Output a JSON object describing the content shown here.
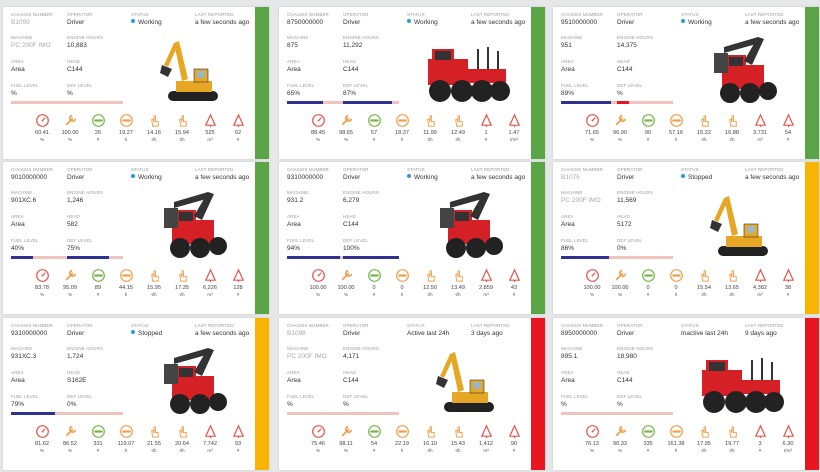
{
  "labels": {
    "chassis": "CHASSIS NUMBER",
    "operator": "OPERATOR",
    "status": "STATUS",
    "last": "LAST REPORTED",
    "machine": "MACHINE",
    "engine": "ENGINE HOURS",
    "area": "AREA",
    "head": "HEAD",
    "fuel": "FUEL LEVEL",
    "def": "DEF LEVEL"
  },
  "colors": {
    "green": "#5aa646",
    "yellow": "#f8b400",
    "red": "#e8141e",
    "navy": "#2e3192",
    "status_dot": "#2a9bd7"
  },
  "metric_icons": [
    "gauge-icon",
    "wrench-icon",
    "rpm-icon",
    "hours-icon",
    "hand-icon",
    "hand-icon",
    "tree-icon",
    "tree-icon"
  ],
  "cards": [
    {
      "chassis": "B1099",
      "chassis_gray": true,
      "operator": "Driver",
      "status": "Working",
      "status_dot": true,
      "last": "a few seconds ago",
      "machine": "PC 200F IMO",
      "machine_gray": true,
      "engine": "10,883",
      "area": "Area",
      "head": "C144",
      "fuel": "%",
      "fuel_pct": 0,
      "def": "%",
      "def_pct": 0,
      "bar": "green",
      "machine_type": "excavator",
      "metrics": [
        {
          "value": "60.41",
          "unit": "%"
        },
        {
          "value": "100.00",
          "unit": "%"
        },
        {
          "value": "26",
          "unit": "#"
        },
        {
          "value": "19.27",
          "unit": "h"
        },
        {
          "value": "14.16",
          "unit": "t/h"
        },
        {
          "value": "15.94",
          "unit": "t/h"
        },
        {
          "value": "525",
          "unit": "m³"
        },
        {
          "value": "62",
          "unit": "#"
        }
      ]
    },
    {
      "chassis": "8750000000",
      "chassis_gray": false,
      "operator": "Driver",
      "status": "Working",
      "status_dot": true,
      "last": "a few seconds ago",
      "machine": "875",
      "machine_gray": false,
      "engine": "11,292",
      "area": "Area",
      "head": "C144",
      "fuel": "65%",
      "fuel_pct": 65,
      "def": "87%",
      "def_pct": 87,
      "bar": "green",
      "machine_type": "forwarder",
      "metrics": [
        {
          "value": "88.45",
          "unit": "%"
        },
        {
          "value": "98.65",
          "unit": "%"
        },
        {
          "value": "57",
          "unit": "#"
        },
        {
          "value": "18.37",
          "unit": "h"
        },
        {
          "value": "11.99",
          "unit": "t/h"
        },
        {
          "value": "12.49",
          "unit": "t/h"
        },
        {
          "value": "1",
          "unit": "#"
        },
        {
          "value": "1.47",
          "unit": "t/m³"
        }
      ]
    },
    {
      "chassis": "9510000000",
      "chassis_gray": false,
      "operator": "Driver",
      "status": "Working",
      "status_dot": true,
      "last": "a few seconds ago",
      "machine": "951",
      "machine_gray": false,
      "engine": "14,375",
      "area": "Area",
      "head": "C144",
      "fuel": "89%",
      "fuel_pct": 89,
      "def": "%",
      "def_pct": 22,
      "bar": "green",
      "machine_type": "harvester",
      "metrics": [
        {
          "value": "71.65",
          "unit": "%"
        },
        {
          "value": "96.90",
          "unit": "%"
        },
        {
          "value": "90",
          "unit": "#"
        },
        {
          "value": "57.16",
          "unit": "h"
        },
        {
          "value": "15.22",
          "unit": "t/h"
        },
        {
          "value": "16.88",
          "unit": "t/h"
        },
        {
          "value": "3,731",
          "unit": "m³"
        },
        {
          "value": "54",
          "unit": "#"
        }
      ]
    },
    {
      "chassis": "9010000000",
      "chassis_gray": false,
      "operator": "Driver",
      "status": "Working",
      "status_dot": true,
      "last": "a few seconds ago",
      "machine": "901XC.6",
      "machine_gray": false,
      "engine": "1,246",
      "area": "Area",
      "head": "582",
      "fuel": "40%",
      "fuel_pct": 40,
      "def": "75%",
      "def_pct": 75,
      "bar": "green",
      "machine_type": "harvester",
      "metrics": [
        {
          "value": "83.78",
          "unit": "%"
        },
        {
          "value": "95.09",
          "unit": "%"
        },
        {
          "value": "89",
          "unit": "#"
        },
        {
          "value": "44.15",
          "unit": "h"
        },
        {
          "value": "15.95",
          "unit": "t/h"
        },
        {
          "value": "17.35",
          "unit": "t/h"
        },
        {
          "value": "6,226",
          "unit": "m³"
        },
        {
          "value": "128",
          "unit": "#"
        }
      ]
    },
    {
      "chassis": "9310000000",
      "chassis_gray": false,
      "operator": "Driver",
      "status": "Working",
      "status_dot": true,
      "last": "a few seconds ago",
      "machine": "931.2",
      "machine_gray": false,
      "engine": "6,279",
      "area": "Area",
      "head": "C144",
      "fuel": "94%",
      "fuel_pct": 94,
      "def": "100%",
      "def_pct": 100,
      "bar": "green",
      "machine_type": "harvester",
      "metrics": [
        {
          "value": "100.00",
          "unit": "%"
        },
        {
          "value": "100.00",
          "unit": "%"
        },
        {
          "value": "0",
          "unit": "#"
        },
        {
          "value": "0",
          "unit": "h"
        },
        {
          "value": "12.50",
          "unit": "t/h"
        },
        {
          "value": "13.49",
          "unit": "t/h"
        },
        {
          "value": "2,859",
          "unit": "m³"
        },
        {
          "value": "43",
          "unit": "#"
        }
      ]
    },
    {
      "chassis": "B1075",
      "chassis_gray": true,
      "operator": "Driver",
      "status": "Stopped",
      "status_dot": true,
      "last": "a few seconds ago",
      "machine": "PC 200F IMO",
      "machine_gray": true,
      "engine": "11,569",
      "area": "Area",
      "head": "5172",
      "fuel": "86%",
      "fuel_pct": 86,
      "def": "0%",
      "def_pct": 0,
      "bar": "yellow",
      "machine_type": "excavator",
      "metrics": [
        {
          "value": "100.00",
          "unit": "%"
        },
        {
          "value": "100.00",
          "unit": "%"
        },
        {
          "value": "0",
          "unit": "#"
        },
        {
          "value": "0",
          "unit": "h"
        },
        {
          "value": "15.54",
          "unit": "t/h"
        },
        {
          "value": "13.65",
          "unit": "t/h"
        },
        {
          "value": "4,382",
          "unit": "m³"
        },
        {
          "value": "38",
          "unit": "#"
        }
      ]
    },
    {
      "chassis": "9310000000",
      "chassis_gray": false,
      "operator": "Driver",
      "status": "Stopped",
      "status_dot": true,
      "last": "a few seconds ago",
      "machine": "931XC.3",
      "machine_gray": false,
      "engine": "1,724",
      "area": "Area",
      "head": "S162E",
      "fuel": "79%",
      "fuel_pct": 79,
      "def": "0%",
      "def_pct": 0,
      "bar": "yellow",
      "machine_type": "harvester",
      "metrics": [
        {
          "value": "81.62",
          "unit": "%"
        },
        {
          "value": "86.52",
          "unit": "%"
        },
        {
          "value": "331",
          "unit": "#"
        },
        {
          "value": "119.07",
          "unit": "h"
        },
        {
          "value": "21.55",
          "unit": "t/h"
        },
        {
          "value": "20.64",
          "unit": "t/h"
        },
        {
          "value": "7,742",
          "unit": "m³"
        },
        {
          "value": "93",
          "unit": "#"
        }
      ]
    },
    {
      "chassis": "B1098",
      "chassis_gray": true,
      "operator": "Driver",
      "status": "Active last 24h",
      "status_dot": false,
      "last": "3 days ago",
      "machine": "PC 200F IMO",
      "machine_gray": true,
      "engine": "4,171",
      "area": "Area",
      "head": "C144",
      "fuel": "%",
      "fuel_pct": 0,
      "def": "%",
      "def_pct": 0,
      "bar": "red",
      "machine_type": "excavator",
      "metrics": [
        {
          "value": "75.46",
          "unit": "%"
        },
        {
          "value": "98.11",
          "unit": "%"
        },
        {
          "value": "54",
          "unit": "#"
        },
        {
          "value": "22.19",
          "unit": "h"
        },
        {
          "value": "16.10",
          "unit": "t/h"
        },
        {
          "value": "15.43",
          "unit": "t/h"
        },
        {
          "value": "1,412",
          "unit": "m³"
        },
        {
          "value": "90",
          "unit": "#"
        }
      ]
    },
    {
      "chassis": "8950000000",
      "chassis_gray": false,
      "operator": "Driver",
      "status": "Inactive last 24h",
      "status_dot": false,
      "last": "9 days ago",
      "machine": "895.1",
      "machine_gray": false,
      "engine": "18,980",
      "area": "Area",
      "head": "C144",
      "fuel": "%",
      "fuel_pct": 0,
      "def": "%",
      "def_pct": 0,
      "bar": "red",
      "machine_type": "forwarder",
      "metrics": [
        {
          "value": "76.13",
          "unit": "%"
        },
        {
          "value": "90.33",
          "unit": "%"
        },
        {
          "value": "335",
          "unit": "#"
        },
        {
          "value": "161.38",
          "unit": "h"
        },
        {
          "value": "17.95",
          "unit": "t/h"
        },
        {
          "value": "19.77",
          "unit": "t/h"
        },
        {
          "value": "3",
          "unit": "#"
        },
        {
          "value": "6.30",
          "unit": "t/m³"
        }
      ]
    }
  ]
}
